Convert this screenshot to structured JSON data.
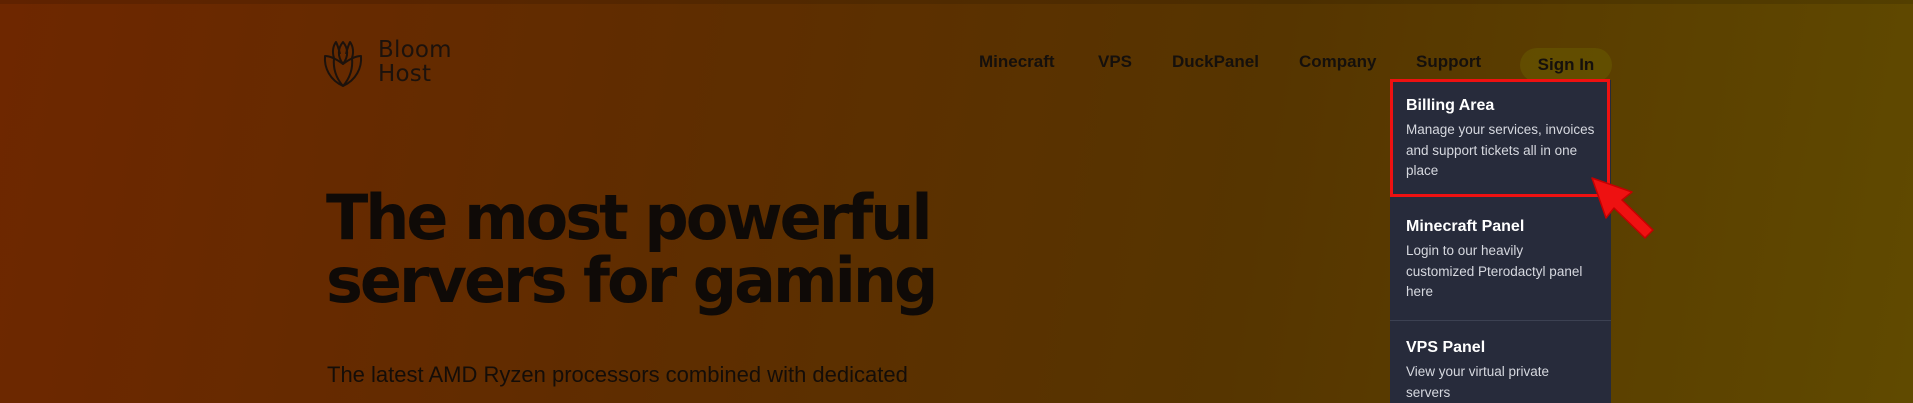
{
  "brand": {
    "name_line1": "Bloom",
    "name_line2": "Host",
    "logo_icon": "tulip-logo-icon"
  },
  "nav": {
    "items": [
      {
        "label": "Minecraft"
      },
      {
        "label": "VPS"
      },
      {
        "label": "DuckPanel"
      },
      {
        "label": "Company"
      },
      {
        "label": "Support"
      }
    ],
    "signin_label": "Sign In"
  },
  "hero": {
    "title_line1": "The most powerful",
    "title_line2": "servers for gaming",
    "subtitle": "The latest AMD Ryzen processors combined with dedicated"
  },
  "support_dropdown": {
    "items": [
      {
        "title": "Billing Area",
        "description": "Manage your services, invoices and support tickets all in one place"
      },
      {
        "title": "Minecraft Panel",
        "description": "Login to our heavily customized Pterodactyl panel here"
      },
      {
        "title": "VPS Panel",
        "description": "View your virtual private servers"
      }
    ]
  },
  "annotation": {
    "highlight_color": "#ee1111",
    "arrow_icon": "red-pointer-arrow-icon"
  },
  "colors": {
    "dropdown_bg": "#272b3b",
    "text_dark": "#0f0a07",
    "background_start": "#6e2700",
    "background_end": "#604a00"
  }
}
